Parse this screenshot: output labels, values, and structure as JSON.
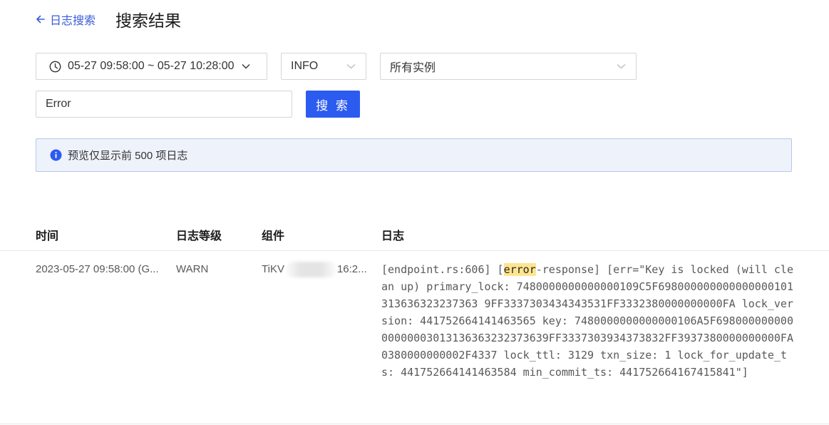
{
  "header": {
    "back_label": "日志搜索",
    "title": "搜索结果"
  },
  "filters": {
    "time_range": "05-27 09:58:00 ~ 05-27 10:28:00",
    "level": "INFO",
    "instance": "所有实例",
    "search_value": "Error",
    "search_button": "搜 索"
  },
  "banner": {
    "text": "预览仅显示前 500 项日志"
  },
  "table": {
    "columns": [
      "时间",
      "日志等级",
      "组件",
      "日志"
    ],
    "rows": [
      {
        "time": "2023-05-27 09:58:00 (G...",
        "level": "WARN",
        "component_prefix": "TiKV",
        "component_suffix": "16:2...",
        "log_before": "[endpoint.rs:606] [",
        "log_highlight": "error",
        "log_after": "-response] [err=\"Key is locked (will clean up) primary_lock: 7480000000000000109C5F698000000000000000101313636323237363 9FF3337303434343531FF3332380000000000FA lock_version: 441752664141463565 key: 7480000000000000106A5F69800000000000000003013136363232373639FF3337303934373832FF3937380000000000FA0380000000002F4337 lock_ttl: 3129 txn_size: 1 lock_for_update_ts: 441752664141463584 min_commit_ts: 441752664167415841\"]"
      }
    ]
  },
  "colors": {
    "accent": "#2c5bf0",
    "link": "#3b5bdb",
    "banner_bg": "#eef2fb",
    "highlight": "#ffe58f"
  }
}
